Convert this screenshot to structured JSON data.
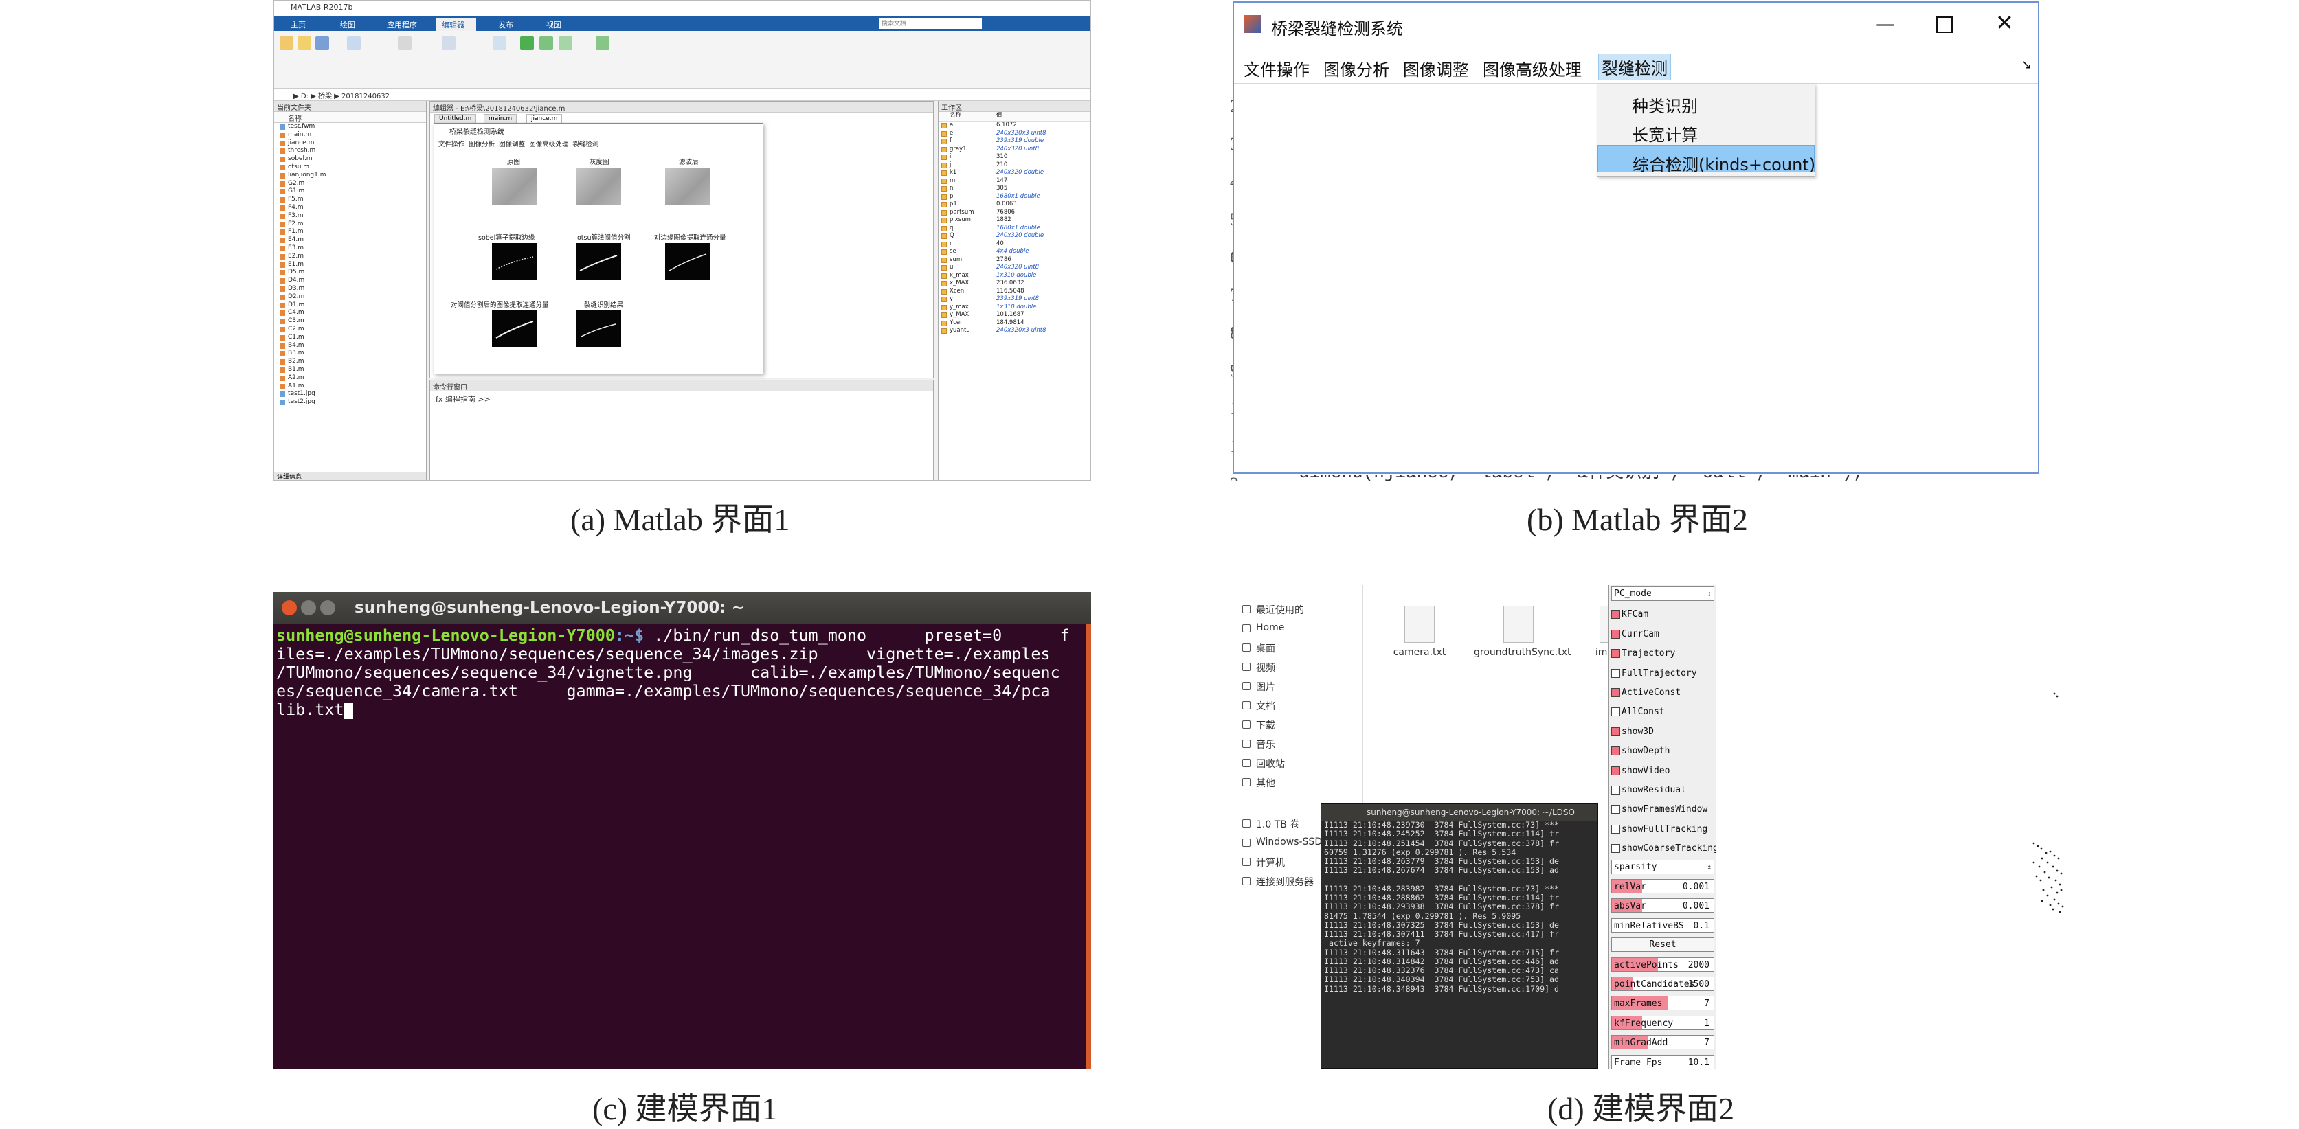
{
  "captions": {
    "a": "(a) Matlab 界面1",
    "b": "(b) Matlab 界面2",
    "c": "(c) 建模界面1",
    "d": "(d) 建模界面2"
  },
  "panel_a": {
    "window_title": "MATLAB R2017b",
    "tabs": [
      "主页",
      "绘图",
      "应用程序",
      "编辑器",
      "发布",
      "视图"
    ],
    "active_tab": "编辑器",
    "search_placeholder": "搜索文档",
    "address": "▶ D: ▶ 桥梁 ▶ 20181240632",
    "files_header": "当前文件夹",
    "files_col": "名称",
    "files": [
      "test.fwm",
      "main.m",
      "jiance.m",
      "thresh.m",
      "sobel.m",
      "otsu.m",
      "lianjiong1.m",
      "G2.m",
      "G1.m",
      "F5.m",
      "F4.m",
      "F3.m",
      "F2.m",
      "F1.m",
      "E4.m",
      "E3.m",
      "E2.m",
      "E1.m",
      "D5.m",
      "D4.m",
      "D3.m",
      "D2.m",
      "D1.m",
      "C4.m",
      "C3.m",
      "C2.m",
      "C1.m",
      "B4.m",
      "B3.m",
      "B2.m",
      "B1.m",
      "A2.m",
      "A1.m",
      "test1.jpg",
      "test2.jpg"
    ],
    "files_footer": "详细信息",
    "editor_title": "编辑器 - E:\\桥梁\\20181240632\\jiance.m",
    "editor_tabs": [
      "Untitled.m",
      "main.m",
      "jiance.m"
    ],
    "cmd_header": "命令行窗口",
    "cmd_prompt": "fx 编程指南 >>",
    "ws_header": "工作区",
    "ws_col_name": "名称",
    "ws_col_value": "值",
    "workspace": [
      {
        "n": "a",
        "v": "6.1072",
        "t": false
      },
      {
        "n": "e",
        "v": "240x320x3 uint8",
        "t": true
      },
      {
        "n": "f",
        "v": "239x319 double",
        "t": true
      },
      {
        "n": "gray1",
        "v": "240x320 uint8",
        "t": true
      },
      {
        "n": "i",
        "v": "310",
        "t": false
      },
      {
        "n": "j",
        "v": "210",
        "t": false
      },
      {
        "n": "k1",
        "v": "240x320 double",
        "t": true
      },
      {
        "n": "m",
        "v": "147",
        "t": false
      },
      {
        "n": "n",
        "v": "305",
        "t": false
      },
      {
        "n": "p",
        "v": "1680x1 double",
        "t": true
      },
      {
        "n": "p1",
        "v": "0.0063",
        "t": false
      },
      {
        "n": "partsum",
        "v": "76806",
        "t": false
      },
      {
        "n": "pixsum",
        "v": "1882",
        "t": false
      },
      {
        "n": "q",
        "v": "1680x1 double",
        "t": true
      },
      {
        "n": "Q",
        "v": "240x320 double",
        "t": true
      },
      {
        "n": "r",
        "v": "40",
        "t": false
      },
      {
        "n": "se",
        "v": "4x4 double",
        "t": true
      },
      {
        "n": "sum",
        "v": "2786",
        "t": false
      },
      {
        "n": "u",
        "v": "240x320 uint8",
        "t": true
      },
      {
        "n": "x_max",
        "v": "1x310 double",
        "t": true
      },
      {
        "n": "x_MAX",
        "v": "236.0632",
        "t": false
      },
      {
        "n": "Xcen",
        "v": "116.5048",
        "t": false
      },
      {
        "n": "y",
        "v": "239x319 uint8",
        "t": true
      },
      {
        "n": "y_max",
        "v": "1x310 double",
        "t": true
      },
      {
        "n": "y_MAX",
        "v": "101.1687",
        "t": false
      },
      {
        "n": "Ycen",
        "v": "184.9814",
        "t": false
      },
      {
        "n": "yuantu",
        "v": "240x320x3 uint8",
        "t": true
      }
    ],
    "figure_title": "桥梁裂缝检测系统",
    "figure_menu": [
      "文件操作",
      "图像分析",
      "图像调整",
      "图像高级处理",
      "裂缝检测"
    ],
    "thumb_labels": [
      "原图",
      "灰度图",
      "滤波后",
      "sobel算子提取边缘",
      "otsu算法阈值分割",
      "对边缘图像提取连通分量",
      "对阈值分割后的图像提取连通分量",
      "裂缝识别结果"
    ]
  },
  "panel_b": {
    "window_title": "桥梁裂缝检测系统",
    "menu": [
      "文件操作",
      "图像分析",
      "图像调整",
      "图像高级处理",
      "裂缝检测"
    ],
    "selected_menu": "裂缝检测",
    "dropdown": [
      "种类识别",
      "长宽计算",
      "综合检测(kinds+count)"
    ],
    "highlighted_item": "综合检测(kinds+count)",
    "line_numbers": [
      "2",
      "3",
      "4",
      "5",
      "6",
      "7",
      "8",
      "9",
      "1",
      "1",
      "2"
    ],
    "bg_code": "uimenu(hjiance, 'label', '&种类识别', 'call', 'main');"
  },
  "panel_c": {
    "window_title": "sunheng@sunheng-Lenovo-Legion-Y7000: ~",
    "prompt_user": "sunheng@sunheng-Lenovo-Legion-Y7000",
    "prompt_path": ":~$",
    "cmd_lines": [
      " ./bin/run_dso_tum_mono      preset=0      f",
      "iles=./examples/TUMmono/sequences/sequence_34/images.zip     vignette=./examples",
      "/TUMmono/sequences/sequence_34/vignette.png      calib=./examples/TUMmono/sequenc",
      "es/sequence_34/camera.txt     gamma=./examples/TUMmono/sequences/sequence_34/pca",
      "lib.txt"
    ]
  },
  "panel_d": {
    "nav": [
      "最近使用的",
      "Home",
      "桌面",
      "视频",
      "图片",
      "文档",
      "下载",
      "音乐",
      "回收站",
      "其他",
      "1.0 TB 卷",
      "Windows-SSD",
      "计算机",
      "连接到服务器"
    ],
    "files": [
      "camera.txt",
      "groundtruthSync.txt",
      "ima"
    ],
    "term_title": "sunheng@sunheng-Lenovo-Legion-Y7000: ~/LDSO",
    "term_lines": [
      "I1113 21:10:48.239730  3784 FullSystem.cc:73] ***",
      "I1113 21:10:48.245252  3784 FullSystem.cc:114] tr",
      "I1113 21:10:48.251454  3784 FullSystem.cc:378] fr",
      "60759 1.31276 (exp 0.299781 ). Res 5.534",
      "I1113 21:10:48.263779  3784 FullSystem.cc:153] de",
      "I1113 21:10:48.267674  3784 FullSystem.cc:153] ad",
      "",
      "I1113 21:10:48.283982  3784 FullSystem.cc:73] ***",
      "I1113 21:10:48.288862  3784 FullSystem.cc:114] tr",
      "I1113 21:10:48.293938  3784 FullSystem.cc:378] fr",
      "81475 1.78544 (exp 0.299781 ). Res 5.9095",
      "I1113 21:10:48.307325  3784 FullSystem.cc:153] de",
      "I1113 21:10:48.307411  3784 FullSystem.cc:417] fr",
      " active keyframes: 7",
      "I1113 21:10:48.311643  3784 FullSystem.cc:715] fr",
      "I1113 21:10:48.314842  3784 FullSystem.cc:446] ad",
      "I1113 21:10:48.332376  3784 FullSystem.cc:473] ca",
      "I1113 21:10:48.340394  3784 FullSystem.cc:753] ad",
      "I1113 21:10:48.348943  3784 FullSystem.cc:1709] d"
    ],
    "mode_select": "PC_mode",
    "checks": [
      {
        "label": "KFCam",
        "on": true
      },
      {
        "label": "CurrCam",
        "on": true
      },
      {
        "label": "Trajectory",
        "on": true
      },
      {
        "label": "FullTrajectory",
        "on": false
      },
      {
        "label": "ActiveConst",
        "on": true
      },
      {
        "label": "AllConst",
        "on": false
      },
      {
        "label": "show3D",
        "on": true
      },
      {
        "label": "showDepth",
        "on": true
      },
      {
        "label": "showVideo",
        "on": true
      },
      {
        "label": "showResidual",
        "on": false
      },
      {
        "label": "showFramesWindow",
        "on": false
      },
      {
        "label": "showFullTracking",
        "on": false
      },
      {
        "label": "showCoarseTracking",
        "on": false
      }
    ],
    "sparsity_label": "sparsity",
    "sliders": [
      {
        "label": "relVar",
        "value": "0.001",
        "level": 0.3
      },
      {
        "label": "absVar",
        "value": "0.001",
        "level": 0.3
      },
      {
        "label": "minRelativeBS",
        "value": "0.1",
        "level": 0.0
      }
    ],
    "reset_label": "Reset",
    "sliders2": [
      {
        "label": "activePoints",
        "value": "2000",
        "level": 0.45
      },
      {
        "label": "pointCandidates",
        "value": "1500",
        "level": 0.2
      },
      {
        "label": "maxFrames",
        "value": "7",
        "level": 0.55
      },
      {
        "label": "kfFrequency",
        "value": "1",
        "level": 0.3
      },
      {
        "label": "minGradAdd",
        "value": "7",
        "level": 0.35
      },
      {
        "label": "Frame Fps",
        "value": "10.1",
        "level": 0.0
      }
    ]
  }
}
